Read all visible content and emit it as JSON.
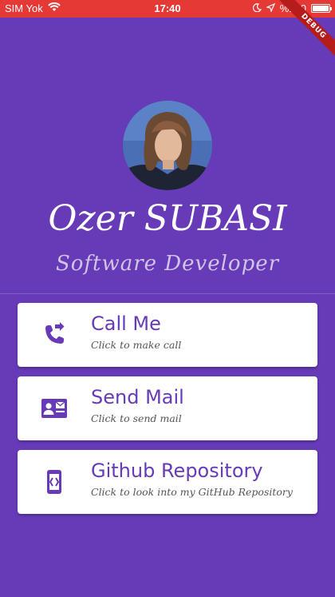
{
  "status_bar": {
    "carrier": "SIM Yok",
    "time": "17:40",
    "battery": "%100"
  },
  "debug_banner": "DEBUG",
  "profile": {
    "name": "Ozer SUBASI",
    "title": "Software Developer"
  },
  "cards": [
    {
      "title": "Call Me",
      "subtitle": "Click to make call",
      "icon": "phone-forward-icon"
    },
    {
      "title": "Send Mail",
      "subtitle": "Click to send mail",
      "icon": "contact-mail-icon"
    },
    {
      "title": "Github Repository",
      "subtitle": "Click to look into my GitHub Repository",
      "icon": "developer-mode-icon"
    }
  ],
  "colors": {
    "background": "#673ab7",
    "status_bar": "#e53935",
    "card": "#ffffff",
    "accent": "#673ab7"
  }
}
